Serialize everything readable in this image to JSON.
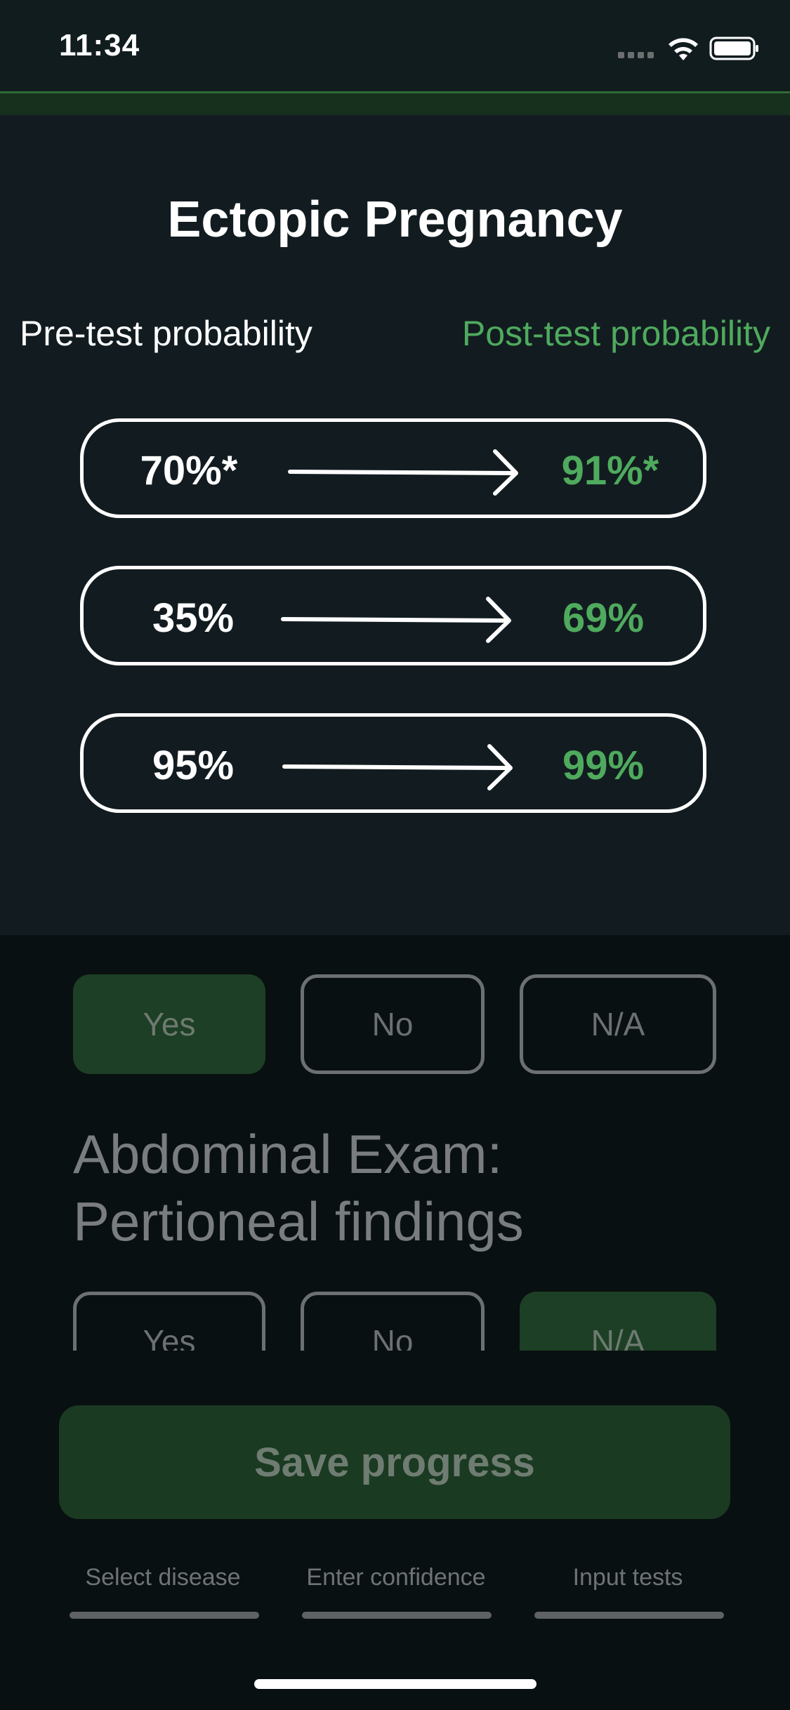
{
  "status_bar": {
    "time": "11:34"
  },
  "results": {
    "title": "Ectopic Pregnancy",
    "pre_header": "Pre-test probability",
    "post_header": "Post-test probability",
    "rows": [
      {
        "pre": "70%*",
        "post": "91%*"
      },
      {
        "pre": "35%",
        "post": "69%"
      },
      {
        "pre": "95%",
        "post": "99%"
      }
    ]
  },
  "questions": {
    "first_options": {
      "yes": "Yes",
      "no": "No",
      "na": "N/A",
      "selected": "Yes"
    },
    "second_label": "Abdominal Exam: Pertioneal findings",
    "second_options": {
      "yes": "Yes",
      "no": "No",
      "na": "N/A",
      "selected": "N/A"
    }
  },
  "save_label": "Save progress",
  "steps": [
    "Select disease",
    "Enter confidence",
    "Input tests"
  ],
  "colors": {
    "accent": "#4faa5e",
    "panel": "#121c20",
    "background": "#091011",
    "selected": "#1d3f25"
  }
}
